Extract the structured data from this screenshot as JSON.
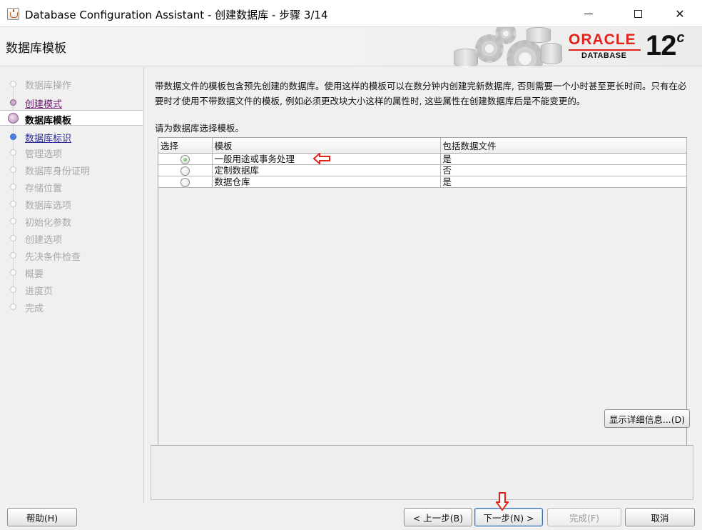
{
  "window": {
    "title": "Database Configuration Assistant - 创建数据库 - 步骤 3/14",
    "controls": [
      "minimize",
      "maximize",
      "close"
    ],
    "close_glyph": "✕"
  },
  "header": {
    "page_title": "数据库模板",
    "logo": {
      "brand": "ORACLE",
      "product": "DATABASE",
      "version": "12",
      "version_suffix": "c"
    }
  },
  "sidebar": {
    "steps": [
      {
        "label": "数据库操作",
        "state": "disabled"
      },
      {
        "label": "创建模式",
        "state": "done"
      },
      {
        "label": "数据库模板",
        "state": "active"
      },
      {
        "label": "数据库标识",
        "state": "link"
      },
      {
        "label": "管理选项",
        "state": "disabled"
      },
      {
        "label": "数据库身份证明",
        "state": "disabled"
      },
      {
        "label": "存储位置",
        "state": "disabled"
      },
      {
        "label": "数据库选项",
        "state": "disabled"
      },
      {
        "label": "初始化参数",
        "state": "disabled"
      },
      {
        "label": "创建选项",
        "state": "disabled"
      },
      {
        "label": "先决条件检查",
        "state": "disabled"
      },
      {
        "label": "概要",
        "state": "disabled"
      },
      {
        "label": "进度页",
        "state": "disabled"
      },
      {
        "label": "完成",
        "state": "disabled"
      }
    ]
  },
  "main": {
    "description": "带数据文件的模板包含预先创建的数据库。使用这样的模板可以在数分钟内创建完新数据库, 否则需要一个小时甚至更长时间。只有在必要时才使用不带数据文件的模板, 例如必须更改块大小这样的属性时, 这些属性在创建数据库后是不能变更的。",
    "prompt": "请为数据库选择模板。",
    "table": {
      "columns": [
        "选择",
        "模板",
        "包括数据文件"
      ],
      "rows": [
        {
          "template": "一般用途或事务处理",
          "includes_datafiles": "是",
          "selected": true
        },
        {
          "template": "定制数据库",
          "includes_datafiles": "否",
          "selected": false
        },
        {
          "template": "数据仓库",
          "includes_datafiles": "是",
          "selected": false
        }
      ]
    },
    "details_button": "显示详细信息...(D)"
  },
  "footer": {
    "help": "帮助(H)",
    "back": "< 上一步(B)",
    "next": "下一步(N) >",
    "finish": "完成(F)",
    "cancel": "取消"
  },
  "colors": {
    "accent_red": "#e2231a",
    "selected_radio": "#3a9d2a",
    "link_blue": "#2a2a98",
    "visited_purple": "#6b1a6b"
  }
}
